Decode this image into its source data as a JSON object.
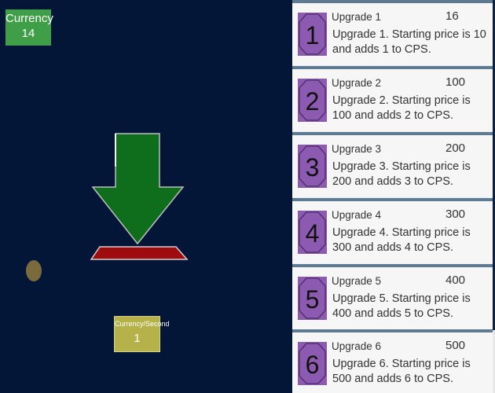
{
  "currency": {
    "label": "Currency",
    "value": "14"
  },
  "cps": {
    "label": "Currency/Second",
    "value": "1"
  },
  "colors": {
    "background": "#031638",
    "currency_box": "#3f9e48",
    "cps_box": "#b6b24a",
    "arrow": "#0f6e1c",
    "arrow_base": "#a00b10",
    "upgrade_icon": "#8c5ab0",
    "card_divider": "#5c7b92"
  },
  "upgrades": [
    {
      "number": "1",
      "name": "Upgrade 1",
      "price": "16",
      "description": "Upgrade 1. Starting price is 10 and adds 1 to CPS."
    },
    {
      "number": "2",
      "name": "Upgrade 2",
      "price": "100",
      "description": "Upgrade 2. Starting price is 100 and adds 2 to CPS."
    },
    {
      "number": "3",
      "name": "Upgrade 3",
      "price": "200",
      "description": "Upgrade 3. Starting price is 200 and adds 3 to CPS."
    },
    {
      "number": "4",
      "name": "Upgrade 4",
      "price": "300",
      "description": "Upgrade 4. Starting price is 300 and adds 4 to CPS."
    },
    {
      "number": "5",
      "name": "Upgrade 5",
      "price": "400",
      "description": "Upgrade 5. Starting price is 400 and adds 5 to CPS."
    },
    {
      "number": "6",
      "name": "Upgrade 6",
      "price": "500",
      "description": "Upgrade 6. Starting price is 500 and adds 6 to CPS."
    }
  ]
}
